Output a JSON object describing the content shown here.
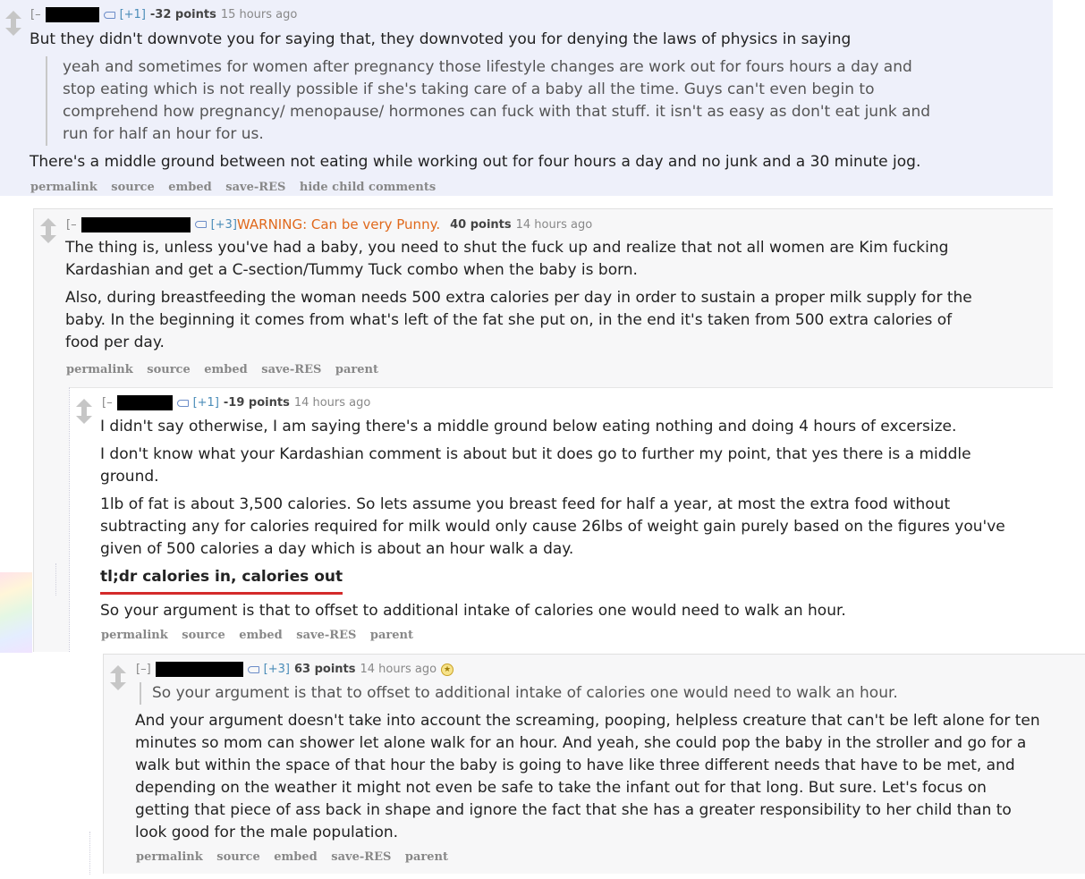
{
  "c1": {
    "collapse": "[–",
    "res_count": "[+1]",
    "points": "-32 points",
    "time": "15 hours ago",
    "paragraphs": [
      "But they didn't downvote you for saying that, they downvoted you for denying the laws of physics in saying"
    ],
    "quote": [
      "yeah and sometimes for women after pregnancy those lifestyle changes are work out for fours hours a day and",
      "stop eating which is not really possible if she's taking care of a baby all the time. Guys can't even begin to",
      "comprehend how pregnancy/ menopause/ hormones can fuck with that stuff. it isn't as easy as don't eat junk and",
      "run for half an hour for us."
    ],
    "after": [
      "There's a middle ground between not eating while working out for four hours a day and no junk and a 30 minute jog."
    ],
    "buttons": [
      "permalink",
      "source",
      "embed",
      "save-RES",
      "hide child comments"
    ]
  },
  "c2": {
    "collapse": "[–",
    "res_count": "[+3]",
    "flair": "WARNING: Can be very Punny.",
    "points": "40 points",
    "time": "14 hours ago",
    "lines": [
      "The thing is, unless you've had a baby, you need to shut the fuck up and realize that not all women are Kim fucking",
      "Kardashian and get a C-section/Tummy Tuck combo when the baby is born.",
      "Also, during breastfeeding the woman needs 500 extra calories per day in order to sustain a proper milk supply for the",
      "baby. In the beginning it comes from what's left of the fat she put on, in the end it's taken from 500 extra calories of",
      "food per day."
    ],
    "buttons": [
      "permalink",
      "source",
      "embed",
      "save-RES",
      "parent"
    ]
  },
  "c3": {
    "collapse": "[–",
    "res_count": "[+1]",
    "points": "-19 points",
    "time": "14 hours ago",
    "lines": [
      "I didn't say otherwise, I am saying there's a middle ground below eating nothing and doing 4 hours of excersize.",
      "I don't know what your Kardashian comment is about but it does go to further my point, that yes there is a middle",
      "ground.",
      "1lb of fat is about 3,500 calories. So lets assume you breast feed for half a year, at most the extra food without",
      "subtracting any for calories required for milk would only cause 26lbs of weight gain purely based on the figures you've",
      "given of 500 calories a day which is about an hour walk a day."
    ],
    "tldr": "tl;dr calories in, calories out",
    "final": "So your argument is that to offset to additional intake of calories one would need to walk an hour.",
    "buttons": [
      "permalink",
      "source",
      "embed",
      "save-RES",
      "parent"
    ]
  },
  "c4": {
    "collapse": "[–]",
    "res_count": "[+3]",
    "points": "63 points",
    "time": "14 hours ago",
    "quote": "So your argument is that to offset to additional intake of calories one would need to walk an hour.",
    "lines": [
      "And your argument doesn't take into account the screaming, pooping, helpless creature that can't be left alone for ten",
      "minutes so mom can shower let alone walk for an hour. And yeah, she could pop the baby in the stroller and go for a",
      "walk but within the space of that hour the baby is going to have like three different needs that have to be met, and",
      "depending on the weather it might not even be safe to take the infant out for that long. But sure. Let's focus on",
      "getting that piece of ass back in shape and ignore the fact that she has a greater responsibility to her child than to",
      "look good for the male population."
    ],
    "buttons": [
      "permalink",
      "source",
      "embed",
      "save-RES",
      "parent"
    ]
  }
}
